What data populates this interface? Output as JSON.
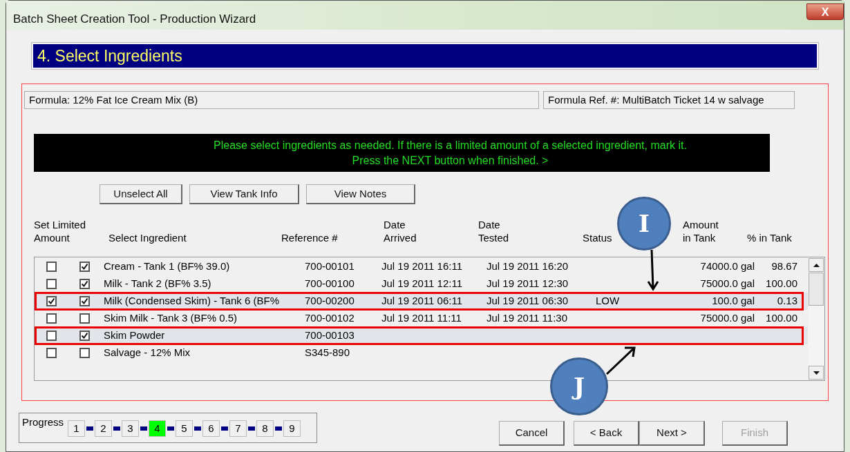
{
  "window": {
    "title": "Batch Sheet Creation Tool - Production Wizard",
    "close": "X"
  },
  "step_title": "4. Select Ingredients",
  "formula": "Formula:  12% Fat Ice Cream Mix (B)",
  "formula_ref": "Formula Ref. #:  MultiBatch Ticket 14 w salvage",
  "message": [
    "Please select ingredients as needed. If there is a limited amount of a selected ingredient, mark it.",
    "Press the NEXT button when finished. >"
  ],
  "toolbar": [
    "Unselect All",
    "View Tank Info",
    "View Notes"
  ],
  "table": {
    "columns": [
      [
        "Set Limited",
        "Amount"
      ],
      [
        "Select Ingredient"
      ],
      [
        "Reference #"
      ],
      [
        "Date",
        "Arrived"
      ],
      [
        "Date",
        "Tested"
      ],
      [
        "Status"
      ],
      [
        "Amount",
        "in Tank"
      ],
      [
        "% in Tank"
      ]
    ],
    "rows": [
      {
        "limited": false,
        "selected": true,
        "highlighted": false,
        "outlined": false,
        "ingredient": "Cream - Tank 1  (BF% 39.0)",
        "reference": "700-00101",
        "arrived": "Jul 19 2011 16:11",
        "tested": "Jul 19 2011 16:20",
        "amount": "74000.0 gal",
        "percent": "98.67"
      },
      {
        "limited": false,
        "selected": true,
        "highlighted": false,
        "outlined": false,
        "ingredient": "Milk - Tank 2  (BF% 3.5)",
        "reference": "700-00100",
        "arrived": "Jul 19 2011 12:11",
        "tested": "Jul 19 2011 12:30",
        "amount": "75000.0 gal",
        "percent": "100.00"
      },
      {
        "limited": true,
        "selected": true,
        "highlighted": true,
        "outlined": true,
        "ingredient": "Milk (Condensed Skim) - Tank 6  (BF%",
        "reference": "700-00200",
        "arrived": "Jul 19 2011 06:11",
        "tested": "Jul 19 2011 06:30",
        "status": "LOW",
        "amount": "100.0 gal",
        "percent": "0.13"
      },
      {
        "limited": false,
        "selected": false,
        "highlighted": false,
        "outlined": false,
        "ingredient": "Skim Milk - Tank 3  (BF% 0.5)",
        "reference": "700-00102",
        "arrived": "Jul 19 2011 11:11",
        "tested": "Jul 19 2011 11:30",
        "amount": "75000.0 gal",
        "percent": "100.00"
      },
      {
        "limited": false,
        "selected": true,
        "highlighted": true,
        "outlined": true,
        "ingredient": "Skim Powder",
        "reference": "700-00103"
      },
      {
        "limited": false,
        "selected": false,
        "highlighted": false,
        "outlined": false,
        "ingredient": "Salvage - 12% Mix",
        "reference": "S345-890"
      }
    ]
  },
  "progress": {
    "label": "Progress",
    "steps": [
      {
        "label": "1",
        "selected": false
      },
      {
        "label": "2",
        "selected": false
      },
      {
        "label": "3",
        "selected": false
      },
      {
        "label": "4",
        "selected": true
      },
      {
        "label": "5",
        "selected": false
      },
      {
        "label": "6",
        "selected": false
      },
      {
        "label": "7",
        "selected": false
      },
      {
        "label": "8",
        "selected": false
      },
      {
        "label": "9",
        "selected": false
      }
    ]
  },
  "buttons": [
    {
      "label": "Cancel",
      "disabled": false
    },
    {
      "label": "< Back",
      "disabled": false
    },
    {
      "label": "Next >",
      "disabled": false
    },
    {
      "label": "Finish",
      "disabled": true
    }
  ],
  "callouts": [
    {
      "label": "I"
    },
    {
      "label": "J"
    }
  ]
}
